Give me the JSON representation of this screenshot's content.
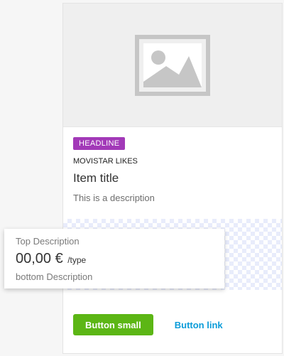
{
  "card": {
    "image": {
      "icon": "image-placeholder-icon"
    },
    "tag": "HEADLINE",
    "pre_title": "MOVISTAR LIKES",
    "title": "Item title",
    "description": "This is a description"
  },
  "price": {
    "top_description": "Top Description",
    "amount": "00,00 €",
    "unit": "/type",
    "bottom_description": "bottom Description"
  },
  "actions": {
    "primary_label": "Button small",
    "link_label": "Button link"
  },
  "colors": {
    "tag_background": "#a239b8",
    "primary_button": "#5cb615",
    "link": "#0b9cd9",
    "pattern": "#e8ecfb"
  }
}
